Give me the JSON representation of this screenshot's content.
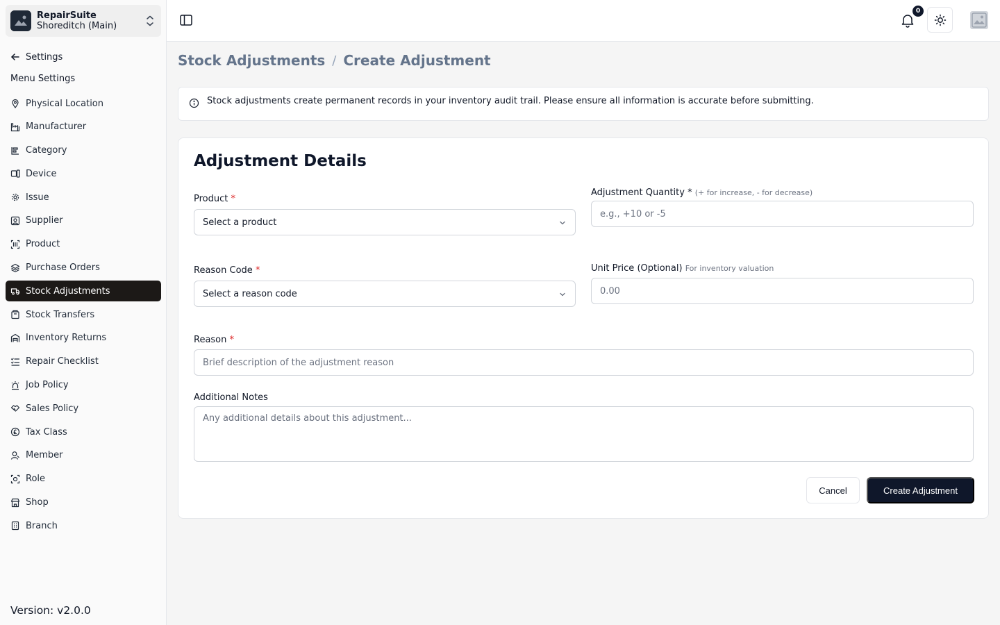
{
  "brand": {
    "name": "RepairSuite",
    "branch": "Shoreditch (Main)"
  },
  "sidebar": {
    "back_label": "Settings",
    "menu_heading": "Menu Settings",
    "items": [
      {
        "label": "Physical Location",
        "icon": "map-pin-icon"
      },
      {
        "label": "Manufacturer",
        "icon": "factory-icon"
      },
      {
        "label": "Category",
        "icon": "category-icon"
      },
      {
        "label": "Device",
        "icon": "device-icon"
      },
      {
        "label": "Issue",
        "icon": "gear-icon"
      },
      {
        "label": "Supplier",
        "icon": "supplier-icon"
      },
      {
        "label": "Product",
        "icon": "barcode-icon"
      },
      {
        "label": "Purchase Orders",
        "icon": "layers-icon"
      },
      {
        "label": "Stock Adjustments",
        "icon": "truck-icon",
        "active": true
      },
      {
        "label": "Stock Transfers",
        "icon": "package-icon"
      },
      {
        "label": "Inventory Returns",
        "icon": "warehouse-icon"
      },
      {
        "label": "Repair Checklist",
        "icon": "checklist-icon"
      },
      {
        "label": "Job Policy",
        "icon": "siren-icon"
      },
      {
        "label": "Sales Policy",
        "icon": "handshake-icon"
      },
      {
        "label": "Tax Class",
        "icon": "currency-icon"
      },
      {
        "label": "Member",
        "icon": "user-icon"
      },
      {
        "label": "Role",
        "icon": "role-icon"
      },
      {
        "label": "Shop",
        "icon": "store-icon"
      },
      {
        "label": "Branch",
        "icon": "building-icon"
      }
    ],
    "version": "Version: v2.0.0"
  },
  "header": {
    "notification_count": "0"
  },
  "breadcrumb": {
    "parent": "Stock Adjustments",
    "separator": "/",
    "current": "Create Adjustment"
  },
  "notice": {
    "text": "Stock adjustments create permanent records in your inventory audit trail. Please ensure all information is accurate before submitting."
  },
  "form": {
    "title": "Adjustment Details",
    "product": {
      "label": "Product",
      "required": "*",
      "value": "Select a product"
    },
    "quantity": {
      "label": "Adjustment Quantity",
      "required": "*",
      "hint": "(+ for increase, - for decrease)",
      "placeholder": "e.g., +10 or -5"
    },
    "reason_code": {
      "label": "Reason Code",
      "required": "*",
      "value": "Select a reason code"
    },
    "unit_price": {
      "label": "Unit Price (Optional)",
      "hint": "For inventory valuation",
      "placeholder": "0.00"
    },
    "reason": {
      "label": "Reason",
      "required": "*",
      "placeholder": "Brief description of the adjustment reason"
    },
    "notes": {
      "label": "Additional Notes",
      "placeholder": "Any additional details about this adjustment..."
    },
    "cancel_label": "Cancel",
    "submit_label": "Create Adjustment"
  },
  "colors": {
    "primary": "#0f172a",
    "active_nav": "#1c1917",
    "required": "#dc2626",
    "muted": "#64748b"
  }
}
